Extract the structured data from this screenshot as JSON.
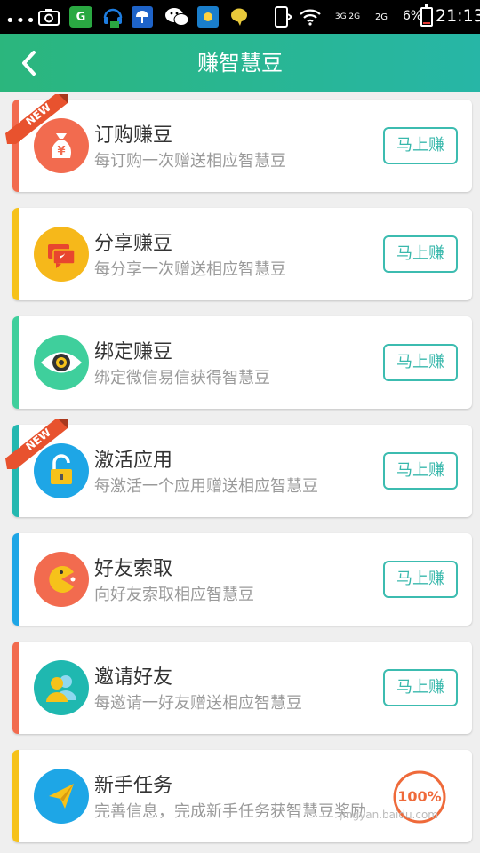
{
  "status_bar": {
    "dots": "•••",
    "signal_text_1": "3G 2G",
    "signal_text_2": "2G",
    "battery": "6%",
    "time": "21:13"
  },
  "header": {
    "title": "赚智慧豆"
  },
  "items": [
    {
      "title": "订购赚豆",
      "desc": "每订购一次赠送相应智慧豆",
      "button": "马上赚",
      "new": "NEW",
      "icon": "money-bag-icon",
      "icon_color": "#f26b4f",
      "accent": "#f26b4f"
    },
    {
      "title": "分享赚豆",
      "desc": "每分享一次赠送相应智慧豆",
      "button": "马上赚",
      "icon": "share-chat-icon",
      "icon_color": "#f6b81a",
      "accent": "#f6c21a"
    },
    {
      "title": "绑定赚豆",
      "desc": "绑定微信易信获得智慧豆",
      "button": "马上赚",
      "icon": "eye-icon",
      "icon_color": "#3fcf9c",
      "accent": "#3fcf9c"
    },
    {
      "title": "激活应用",
      "desc": "每激活一个应用赠送相应智慧豆",
      "button": "马上赚",
      "new": "NEW",
      "icon": "unlock-icon",
      "icon_color": "#1ea6e6",
      "accent": "#24b8b0"
    },
    {
      "title": "好友索取",
      "desc": "向好友索取相应智慧豆",
      "button": "马上赚",
      "icon": "pacman-icon",
      "icon_color": "#f26b4f",
      "accent": "#1ea6e6"
    },
    {
      "title": "邀请好友",
      "desc": "每邀请一好友赠送相应智慧豆",
      "button": "马上赚",
      "icon": "friends-icon",
      "icon_color": "#1fb8b0",
      "accent": "#f26b4f"
    },
    {
      "title": "新手任务",
      "desc": "完善信息，完成新手任务获智慧豆奖励",
      "progress": "100%",
      "progress_value": 1.0,
      "icon": "paper-plane-icon",
      "icon_color": "#1ea6e6",
      "accent": "#f6c21a",
      "watermark": "jingyan.baidu.com"
    }
  ]
}
